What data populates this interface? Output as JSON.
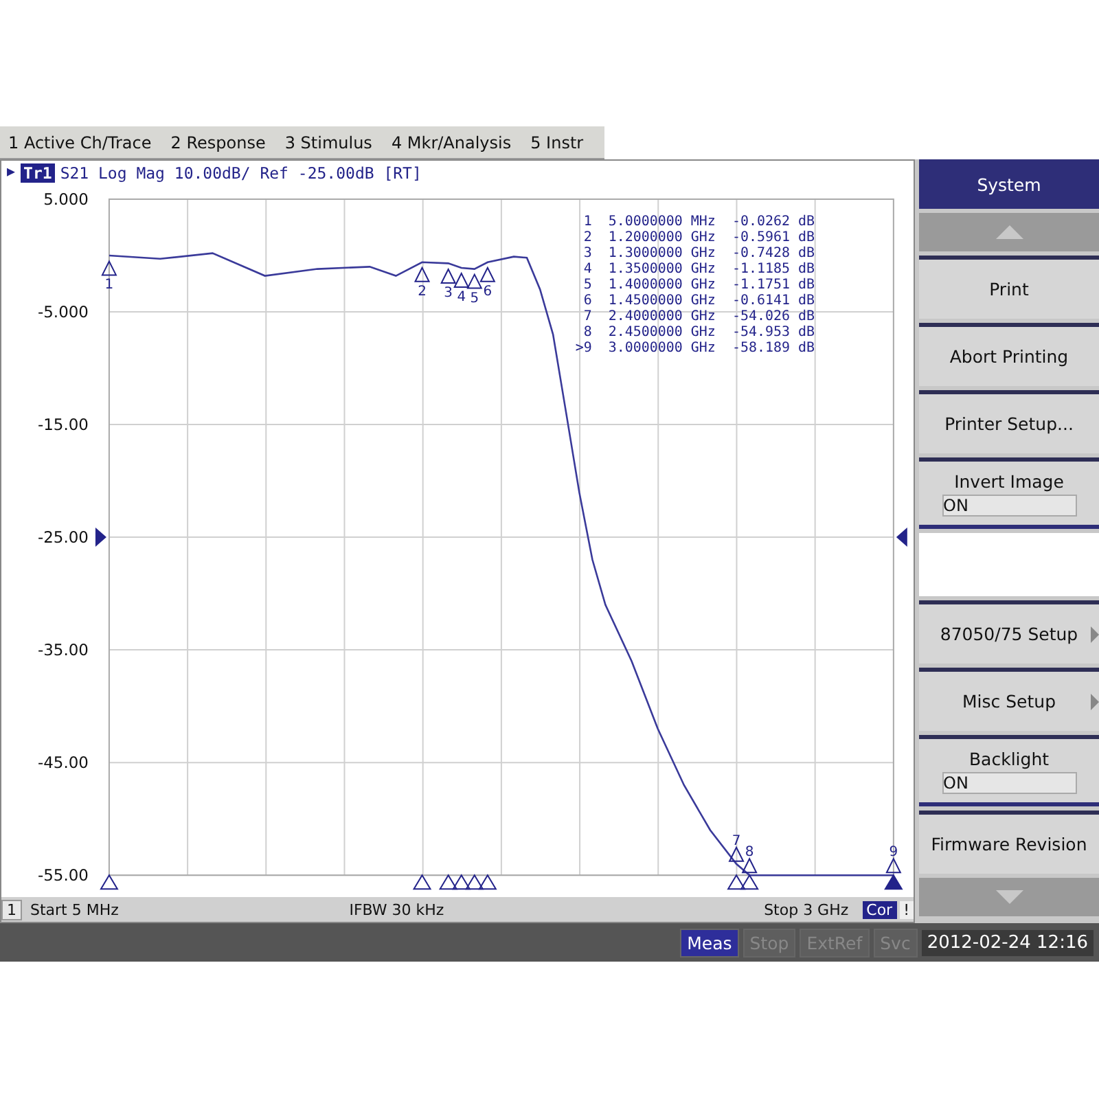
{
  "menu_bar": {
    "items": [
      {
        "label": "1 Active Ch/Trace"
      },
      {
        "label": "2 Response"
      },
      {
        "label": "3 Stimulus"
      },
      {
        "label": "4 Mkr/Analysis"
      },
      {
        "label": "5 Instr"
      }
    ]
  },
  "trace_header": {
    "arrow": "▶",
    "trace": "Tr1",
    "text": "S21 Log Mag 10.00dB/ Ref -25.00dB [RT]"
  },
  "marker_table": [
    {
      "number": "1",
      "stimulus": "5.0000000",
      "unit": "MHz",
      "response": "-0.0262",
      "response_unit": "dB"
    },
    {
      "number": "2",
      "stimulus": "1.2000000",
      "unit": "GHz",
      "response": "-0.5961",
      "response_unit": "dB"
    },
    {
      "number": "3",
      "stimulus": "1.3000000",
      "unit": "GHz",
      "response": "-0.7428",
      "response_unit": "dB"
    },
    {
      "number": "4",
      "stimulus": "1.3500000",
      "unit": "GHz",
      "response": "-1.1185",
      "response_unit": "dB"
    },
    {
      "number": "5",
      "stimulus": "1.4000000",
      "unit": "GHz",
      "response": "-1.1751",
      "response_unit": "dB"
    },
    {
      "number": "6",
      "stimulus": "1.4500000",
      "unit": "GHz",
      "response": "-0.6141",
      "response_unit": "dB"
    },
    {
      "number": "7",
      "stimulus": "2.4000000",
      "unit": "GHz",
      "response": "-54.026",
      "response_unit": "dB"
    },
    {
      "number": "8",
      "stimulus": "2.4500000",
      "unit": "GHz",
      "response": "-54.953",
      "response_unit": "dB"
    },
    {
      "number": ">9",
      "stimulus": "3.0000000",
      "unit": "GHz",
      "response": "-58.189",
      "response_unit": "dB"
    }
  ],
  "y_axis_labels": [
    "5.000",
    "-5.000",
    "-15.00",
    "-25.00",
    "-35.00",
    "-45.00",
    "-55.00"
  ],
  "marker_flags": [
    {
      "label": "1",
      "selected": false
    },
    {
      "label": "2",
      "selected": false
    },
    {
      "label": "3",
      "selected": false
    },
    {
      "label": "4",
      "selected": false
    },
    {
      "label": "5",
      "selected": false
    },
    {
      "label": "6",
      "selected": false
    },
    {
      "label": "7",
      "selected": false
    },
    {
      "label": "8",
      "selected": false
    },
    {
      "label": "9",
      "selected": true
    }
  ],
  "footer": {
    "channel": "1",
    "start": "Start 5 MHz",
    "ifbw": "IFBW 30 kHz",
    "stop": "Stop 3 GHz",
    "cor": "Cor",
    "warning": "!"
  },
  "softkeys": {
    "title": "System",
    "items": [
      {
        "kind": "button",
        "label": "Print"
      },
      {
        "kind": "button",
        "label": "Abort Printing"
      },
      {
        "kind": "button",
        "label": "Printer Setup..."
      },
      {
        "kind": "toggle",
        "label": "Invert Image",
        "value": "ON"
      },
      {
        "kind": "blank"
      },
      {
        "kind": "submenu",
        "label": "87050/75 Setup"
      },
      {
        "kind": "submenu",
        "label": "Misc Setup"
      },
      {
        "kind": "toggle",
        "label": "Backlight",
        "value": "ON"
      },
      {
        "kind": "button",
        "label": "Firmware Revision"
      }
    ]
  },
  "status_bar": {
    "indicators": [
      {
        "label": "Meas",
        "active": true
      },
      {
        "label": "Stop",
        "active": false
      },
      {
        "label": "ExtRef",
        "active": false
      },
      {
        "label": "Svc",
        "active": false
      }
    ],
    "datetime": "2012-02-24 12:16"
  }
}
